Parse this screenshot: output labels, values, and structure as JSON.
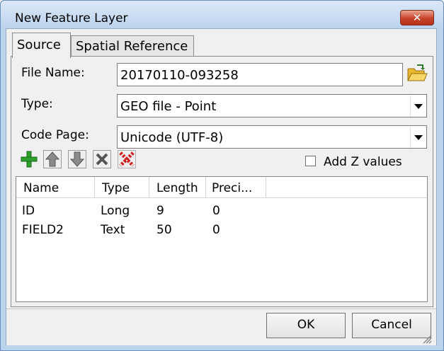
{
  "window": {
    "title": "New Feature Layer",
    "close_glyph": "✕"
  },
  "tabs": [
    {
      "label": "Source",
      "active": true
    },
    {
      "label": "Spatial Reference",
      "active": false
    }
  ],
  "form": {
    "file_name_label": "File Name:",
    "file_name_value": "20170110-093258",
    "type_label": "Type:",
    "type_value": "GEO file - Point",
    "code_page_label": "Code Page:",
    "code_page_value": "Unicode (UTF-8)"
  },
  "toolbar": {
    "icons": [
      "add-field-icon",
      "move-up-icon",
      "move-down-icon",
      "delete-field-icon",
      "delete-all-icon"
    ],
    "add_z_label": "Add Z values",
    "add_z_checked": false
  },
  "fields_table": {
    "columns": [
      "Name",
      "Type",
      "Length",
      "Preci..."
    ],
    "rows": [
      [
        "ID",
        "Long",
        "9",
        "0"
      ],
      [
        "FIELD2",
        "Text",
        "50",
        "0"
      ]
    ]
  },
  "buttons": {
    "ok_label": "OK",
    "cancel_label": "Cancel"
  },
  "colors": {
    "title_bar": "#bfd5ef",
    "close_button": "#c7432b",
    "add_icon": "#2e9e2e",
    "delete_all_icon": "#d02020"
  }
}
